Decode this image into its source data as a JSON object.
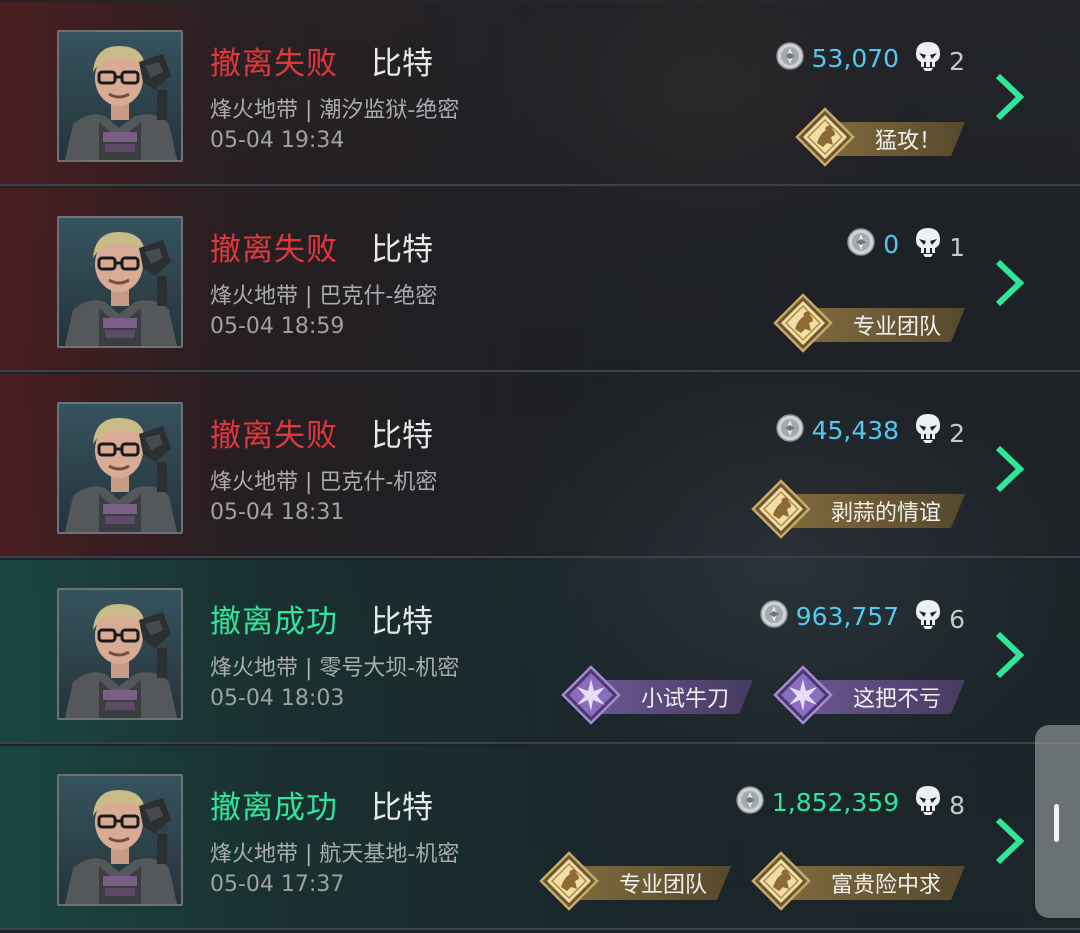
{
  "records": [
    {
      "status": "fail",
      "result": "撤离失败",
      "player": "比特",
      "location": "烽火地带 | 潮汐监狱-绝密",
      "time": "05-04 19:34",
      "money": "53,070",
      "money_color": "blue",
      "kills": "2",
      "badges": [
        {
          "label": "猛攻！",
          "style": "gold",
          "icon": "gold-runner-icon"
        }
      ]
    },
    {
      "status": "fail",
      "result": "撤离失败",
      "player": "比特",
      "location": "烽火地带 | 巴克什-绝密",
      "time": "05-04 18:59",
      "money": "0",
      "money_color": "blue",
      "kills": "1",
      "badges": [
        {
          "label": "专业团队",
          "style": "gold",
          "icon": "gold-runner-icon"
        }
      ]
    },
    {
      "status": "fail",
      "result": "撤离失败",
      "player": "比特",
      "location": "烽火地带 | 巴克什-机密",
      "time": "05-04 18:31",
      "money": "45,438",
      "money_color": "blue",
      "kills": "2",
      "badges": [
        {
          "label": "剥蒜的情谊",
          "style": "gold",
          "icon": "gold-runner-icon"
        }
      ]
    },
    {
      "status": "success",
      "result": "撤离成功",
      "player": "比特",
      "location": "烽火地带 | 零号大坝-机密",
      "time": "05-04 18:03",
      "money": "963,757",
      "money_color": "blue",
      "kills": "6",
      "badges": [
        {
          "label": "小试牛刀",
          "style": "purple",
          "icon": "purple-burst-icon"
        },
        {
          "label": "这把不亏",
          "style": "purple",
          "icon": "purple-burst-icon"
        }
      ]
    },
    {
      "status": "success",
      "result": "撤离成功",
      "player": "比特",
      "location": "烽火地带 | 航天基地-机密",
      "time": "05-04 17:37",
      "money": "1,852,359",
      "money_color": "green",
      "kills": "8",
      "badges": [
        {
          "label": "专业团队",
          "style": "gold",
          "icon": "gold-runner-icon"
        },
        {
          "label": "富贵险中求",
          "style": "gold",
          "icon": "gold-runner-icon"
        }
      ]
    }
  ],
  "colors": {
    "fail": "#e0373b",
    "success": "#2fe69a",
    "money_blue": "#56c8f0",
    "money_green": "#2fe69a",
    "chevron": "#2fe69a"
  },
  "icons": {
    "currency": "silver-coin-icon",
    "kills": "skull-icon",
    "more": "chevron-right-icon"
  }
}
